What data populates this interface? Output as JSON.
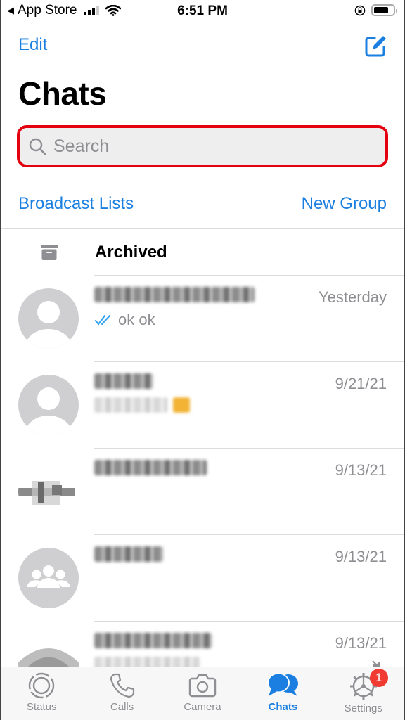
{
  "status_bar": {
    "back_label": "App Store",
    "time": "6:51 PM",
    "battery_level": 0.75
  },
  "header": {
    "edit_label": "Edit",
    "title": "Chats",
    "search_placeholder": "Search",
    "search_value": "",
    "search_highlight_color": "#e4000f"
  },
  "links": {
    "broadcast_lists": "Broadcast Lists",
    "new_group": "New Group"
  },
  "archived": {
    "label": "Archived"
  },
  "chats": [
    {
      "name": "[redacted phone number]",
      "time": "Yesterday",
      "preview": "ok ok",
      "read_receipt": "double-check-read",
      "avatar": "default-person"
    },
    {
      "name": "[redacted]",
      "time": "9/21/21",
      "preview": "[redacted]",
      "avatar": "default-person"
    },
    {
      "name": "[redacted]",
      "time": "9/13/21",
      "preview": "",
      "avatar": "blurred-image"
    },
    {
      "name": "[redacted]",
      "time": "9/13/21",
      "preview": "",
      "avatar": "default-group"
    },
    {
      "name": "[redacted]",
      "time": "9/13/21",
      "preview": "[redacted]",
      "avatar": "blurred-image",
      "muted": true
    }
  ],
  "tabs": [
    {
      "label": "Status",
      "icon": "status-icon",
      "active": false
    },
    {
      "label": "Calls",
      "icon": "phone-icon",
      "active": false
    },
    {
      "label": "Camera",
      "icon": "camera-icon",
      "active": false
    },
    {
      "label": "Chats",
      "icon": "chat-bubbles-icon",
      "active": true
    },
    {
      "label": "Settings",
      "icon": "gear-icon",
      "active": false,
      "badge": "1"
    }
  ],
  "colors": {
    "accent": "#1a7fe0",
    "read_receipt": "#34a3f0",
    "badge": "#f13a31",
    "secondary_text": "#8e8e93"
  }
}
